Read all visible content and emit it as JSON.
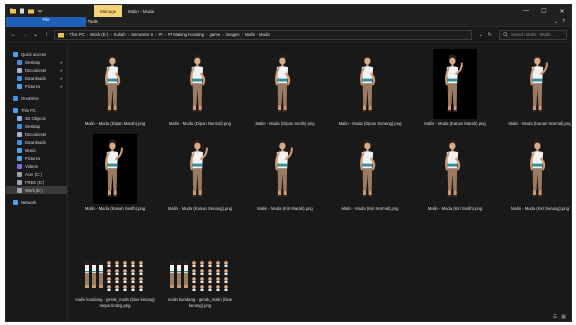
{
  "titlebar": {
    "manage_label": "Manage",
    "window_title": "Malin - Muda",
    "minimize": "—",
    "maximize": "☐",
    "close": "✕"
  },
  "ribbon": {
    "tabs": [
      "File",
      "Home",
      "Share",
      "View",
      "Picture Tools"
    ]
  },
  "address": {
    "back": "←",
    "forward": "→",
    "up_history": "⌄",
    "up": "↑",
    "crumbs": [
      "This PC",
      "Work (E:)",
      "Kuliah",
      "Semester 6",
      "PI",
      "PI Making Kostang",
      "game",
      "images",
      "Malin - Muda"
    ],
    "dropdown": "⌄",
    "refresh": "↻",
    "search_placeholder": "Search Malin - Muda"
  },
  "sidebar": {
    "items": [
      {
        "label": "Quick access",
        "level": 0,
        "icon": "star-icon",
        "color": "#4aa3f0"
      },
      {
        "label": "Desktop",
        "level": 1,
        "icon": "desktop-icon",
        "color": "#3d8fe0",
        "pinned": true
      },
      {
        "label": "Documents",
        "level": 1,
        "icon": "documents-icon",
        "color": "#a7b6c9",
        "pinned": true
      },
      {
        "label": "Downloads",
        "level": 1,
        "icon": "downloads-icon",
        "color": "#3d8fe0",
        "pinned": true
      },
      {
        "label": "Pictures",
        "level": 1,
        "icon": "pictures-icon",
        "color": "#4aa3f0",
        "pinned": true
      },
      {
        "label": "OneDrive",
        "level": 0,
        "icon": "cloud-icon",
        "color": "#3d8fe0",
        "gap": true
      },
      {
        "label": "This PC",
        "level": 0,
        "icon": "pc-icon",
        "color": "#4aa3f0",
        "gap": true
      },
      {
        "label": "3D Objects",
        "level": 1,
        "icon": "3d-objects-icon",
        "color": "#7fb4e8"
      },
      {
        "label": "Desktop",
        "level": 1,
        "icon": "desktop-icon",
        "color": "#3d8fe0"
      },
      {
        "label": "Documents",
        "level": 1,
        "icon": "documents-icon",
        "color": "#a7b6c9"
      },
      {
        "label": "Downloads",
        "level": 1,
        "icon": "downloads-icon",
        "color": "#3d8fe0"
      },
      {
        "label": "Music",
        "level": 1,
        "icon": "music-icon",
        "color": "#4aa3f0"
      },
      {
        "label": "Pictures",
        "level": 1,
        "icon": "pictures-icon",
        "color": "#4aa3f0"
      },
      {
        "label": "Videos",
        "level": 1,
        "icon": "videos-icon",
        "color": "#7a6fd8"
      },
      {
        "label": "Acer (C:)",
        "level": 1,
        "icon": "drive-icon",
        "color": "#9aa4ae"
      },
      {
        "label": "FREE (D:)",
        "level": 1,
        "icon": "drive-icon",
        "color": "#9aa4ae"
      },
      {
        "label": "Work (E:)",
        "level": 1,
        "icon": "drive-icon",
        "color": "#9aa4ae",
        "selected": true
      },
      {
        "label": "Network",
        "level": 0,
        "icon": "network-icon",
        "color": "#4aa3f0",
        "gap": true
      }
    ]
  },
  "files": [
    {
      "name": "Malin - Muda (Dipan Marah).png",
      "black": false,
      "pose": "hips"
    },
    {
      "name": "Malin - Muda (Dipan Normal).png",
      "black": false,
      "pose": "hips"
    },
    {
      "name": "Malin - Muda (Dipan Sedih).png",
      "black": false,
      "pose": "hips"
    },
    {
      "name": "Malin - Muda (Dipan Senang).png",
      "black": false,
      "pose": "hips"
    },
    {
      "name": "Malin - Muda (Kanan Marah).png",
      "black": true,
      "pose": "raise"
    },
    {
      "name": "Malin - Muda (Kanan Normal).png",
      "black": false,
      "pose": "raise"
    },
    {
      "name": "Malin - Muda (Kanan Sedih).png",
      "black": true,
      "pose": "raise"
    },
    {
      "name": "Malin - Muda (Kanan Senang).png",
      "black": false,
      "pose": "raise"
    },
    {
      "name": "Malin - Muda (Kiri Marah).png",
      "black": false,
      "pose": "raise"
    },
    {
      "name": "Malin - Muda (Kiri Normal).png",
      "black": false,
      "pose": "hips"
    },
    {
      "name": "Malin - Muda (Kiri Sedih).png",
      "black": false,
      "pose": "hips"
    },
    {
      "name": "Malin - Muda (Kiri Senang).png",
      "black": false,
      "pose": "hips"
    }
  ],
  "sheets": [
    {
      "name": "malin kundang - gerak_malin (blue kerang) tanpa tinting.png"
    },
    {
      "name": "malin kundang - gerak_malin (blue kerang).png"
    }
  ],
  "status": {
    "details_view": "☰",
    "icons_view": "▦"
  }
}
